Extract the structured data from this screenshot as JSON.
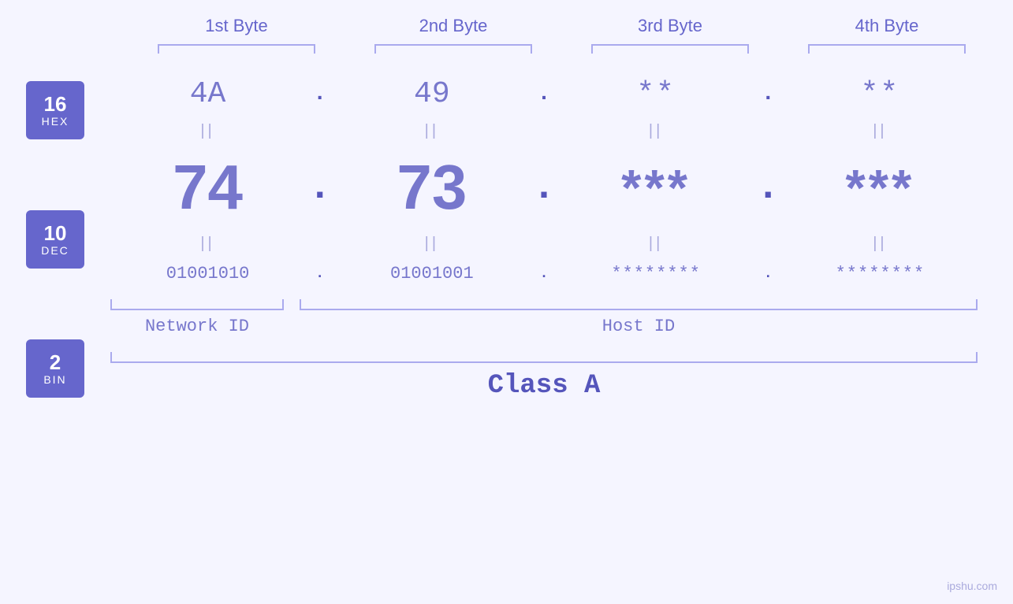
{
  "byteHeaders": [
    "1st Byte",
    "2nd Byte",
    "3rd Byte",
    "4th Byte"
  ],
  "badges": [
    {
      "num": "16",
      "label": "HEX"
    },
    {
      "num": "10",
      "label": "DEC"
    },
    {
      "num": "2",
      "label": "BIN"
    }
  ],
  "hexRow": {
    "values": [
      "4A",
      "49",
      "**",
      "**"
    ],
    "dots": [
      ".",
      ".",
      ".",
      ""
    ]
  },
  "decRow": {
    "values": [
      "74",
      "73",
      "***",
      "***"
    ],
    "dots": [
      ".",
      ".",
      ".",
      ""
    ]
  },
  "binRow": {
    "values": [
      "01001010",
      "01001001",
      "********",
      "********"
    ],
    "dots": [
      ".",
      ".",
      ".",
      ""
    ]
  },
  "labels": {
    "networkId": "Network ID",
    "hostId": "Host ID",
    "classA": "Class A"
  },
  "watermark": "ipshu.com",
  "equals": "||"
}
